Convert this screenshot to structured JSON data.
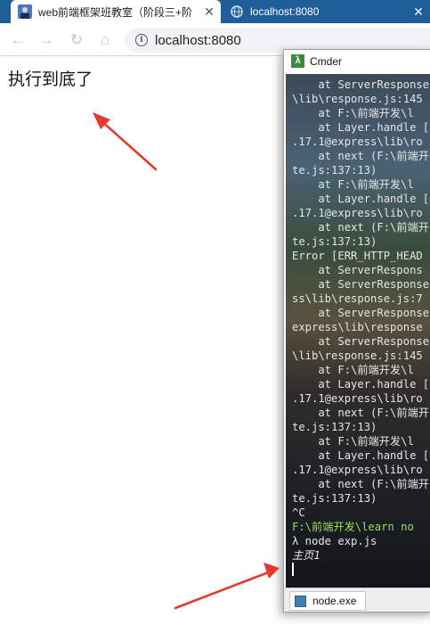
{
  "browser": {
    "tabs": [
      {
        "title": "web前端框架班教室（阶段三+阶",
        "active": true
      },
      {
        "title": "localhost:8080",
        "active": false
      }
    ],
    "url": "localhost:8080"
  },
  "page": {
    "text": "执行到底了"
  },
  "cmder": {
    "title": "Cmder",
    "console_lines": [
      "    at ServerResponse",
      "\\lib\\response.js:145",
      "    at F:\\前端开发\\l",
      "    at Layer.handle [",
      ".17.1@express\\lib\\ro",
      "    at next (F:\\前端开",
      "te.js:137:13)",
      "    at F:\\前端开发\\l",
      "    at Layer.handle [",
      ".17.1@express\\lib\\ro",
      "    at next (F:\\前端开",
      "te.js:137:13)",
      "Error [ERR_HTTP_HEAD",
      "    at ServerRespons",
      "    at ServerResponse",
      "ss\\lib\\response.js:7",
      "    at ServerResponse",
      "express\\lib\\response",
      "    at ServerResponse",
      "\\lib\\response.js:145",
      "    at F:\\前端开发\\l",
      "    at Layer.handle [",
      ".17.1@express\\lib\\ro",
      "    at next (F:\\前端开",
      "te.js:137:13)",
      "    at F:\\前端开发\\l",
      "    at Layer.handle [",
      ".17.1@express\\lib\\ro",
      "    at next (F:\\前端开",
      "te.js:137:13)",
      "^C"
    ],
    "prompt_path": "F:\\前端开发\\learn no",
    "command": "λ node exp.js",
    "output": "主页1",
    "taskbar_tab": "node.exe"
  },
  "colors": {
    "tabstrip": "#1f5d98",
    "annotation_arrow": "#e53b2c",
    "prompt": "#9bdc5a"
  }
}
